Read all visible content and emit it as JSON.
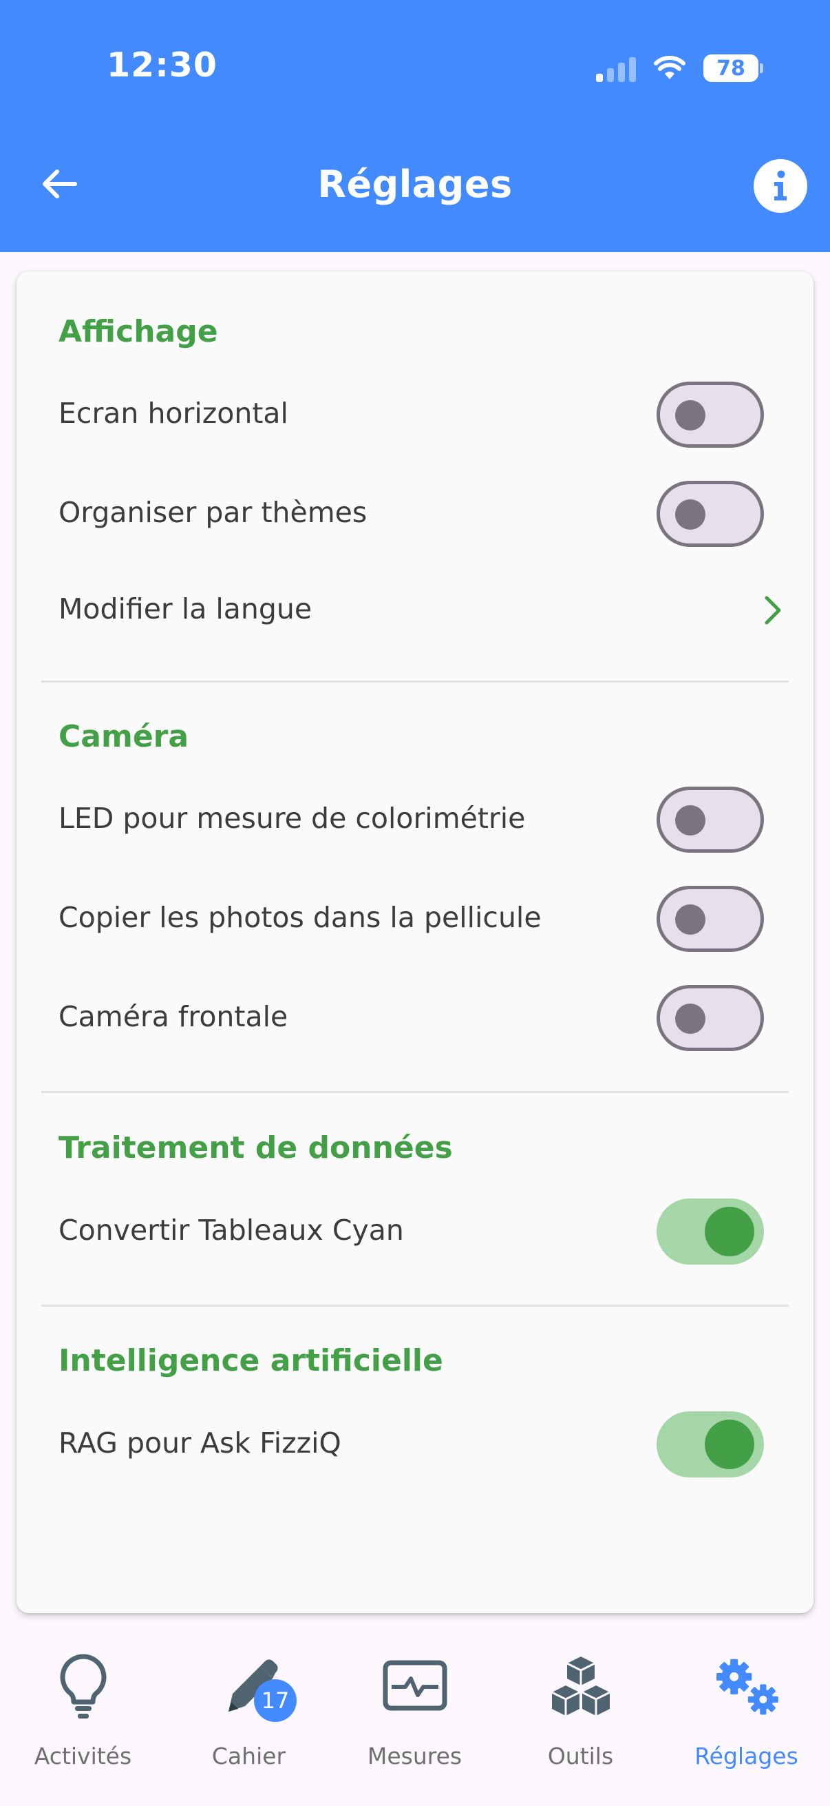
{
  "status_bar": {
    "time": "12:30",
    "battery": "78"
  },
  "header": {
    "title": "Réglages"
  },
  "sections": {
    "affichage": {
      "title": "Affichage",
      "items": [
        {
          "label": "Ecran horizontal",
          "state": "off"
        },
        {
          "label": "Organiser par thèmes",
          "state": "off"
        },
        {
          "label": "Modifier la langue"
        }
      ]
    },
    "camera": {
      "title": "Caméra",
      "items": [
        {
          "label": "LED pour mesure de colorimétrie",
          "state": "off"
        },
        {
          "label": "Copier les photos dans la pellicule",
          "state": "off"
        },
        {
          "label": "Caméra frontale",
          "state": "off"
        }
      ]
    },
    "traitement": {
      "title": "Traitement de données",
      "items": [
        {
          "label": "Convertir Tableaux Cyan",
          "state": "on"
        }
      ]
    },
    "ia": {
      "title": "Intelligence artificielle",
      "items": [
        {
          "label": "RAG pour Ask FizziQ",
          "state": "on"
        }
      ]
    }
  },
  "nav": {
    "items": [
      {
        "label": "Activités",
        "icon": "lightbulb-icon"
      },
      {
        "label": "Cahier",
        "icon": "pen-icon",
        "badge": "17"
      },
      {
        "label": "Mesures",
        "icon": "pulse-monitor-icon"
      },
      {
        "label": "Outils",
        "icon": "cubes-icon"
      },
      {
        "label": "Réglages",
        "icon": "gears-icon",
        "active": true
      }
    ]
  },
  "colors": {
    "primary": "#448aff",
    "accent_green": "#43a047",
    "toggle_on_track": "#a5d6a7",
    "toggle_off_track": "#e7e0ec"
  }
}
